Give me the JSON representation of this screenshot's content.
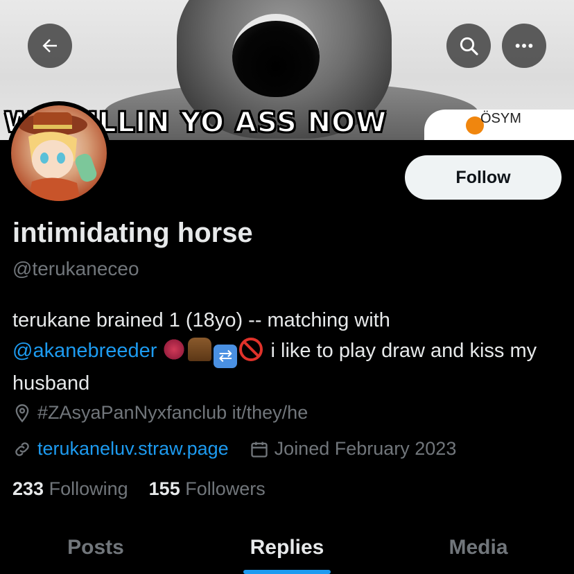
{
  "banner": {
    "meme_text": "WE KILLIN YO ASS NOW",
    "badge_text": "ÖSYM"
  },
  "profile": {
    "display_name": "intimidating horse",
    "handle": "@terukaneceo",
    "follow_label": "Follow",
    "bio_part1": "terukane brained 1 (18yo) -- matching with",
    "bio_mention": "@akanebreeder",
    "bio_part2": "i like to play draw and kiss my husband",
    "location": "#ZAsyaPanNyxfanclub it/they/he",
    "website": "terukaneluv.straw.page",
    "joined": "Joined February 2023",
    "following_count": "233",
    "following_label": "Following",
    "followers_count": "155",
    "followers_label": "Followers"
  },
  "tabs": [
    {
      "label": "Posts"
    },
    {
      "label": "Replies"
    },
    {
      "label": "Media"
    }
  ],
  "active_tab": "Replies",
  "colors": {
    "accent": "#1d9bf0",
    "text": "#e7e9ea",
    "muted": "#71767b",
    "background": "#000000"
  },
  "icons": [
    "back-arrow-icon",
    "search-icon",
    "more-icon",
    "location-pin-icon",
    "link-icon",
    "calendar-icon"
  ]
}
